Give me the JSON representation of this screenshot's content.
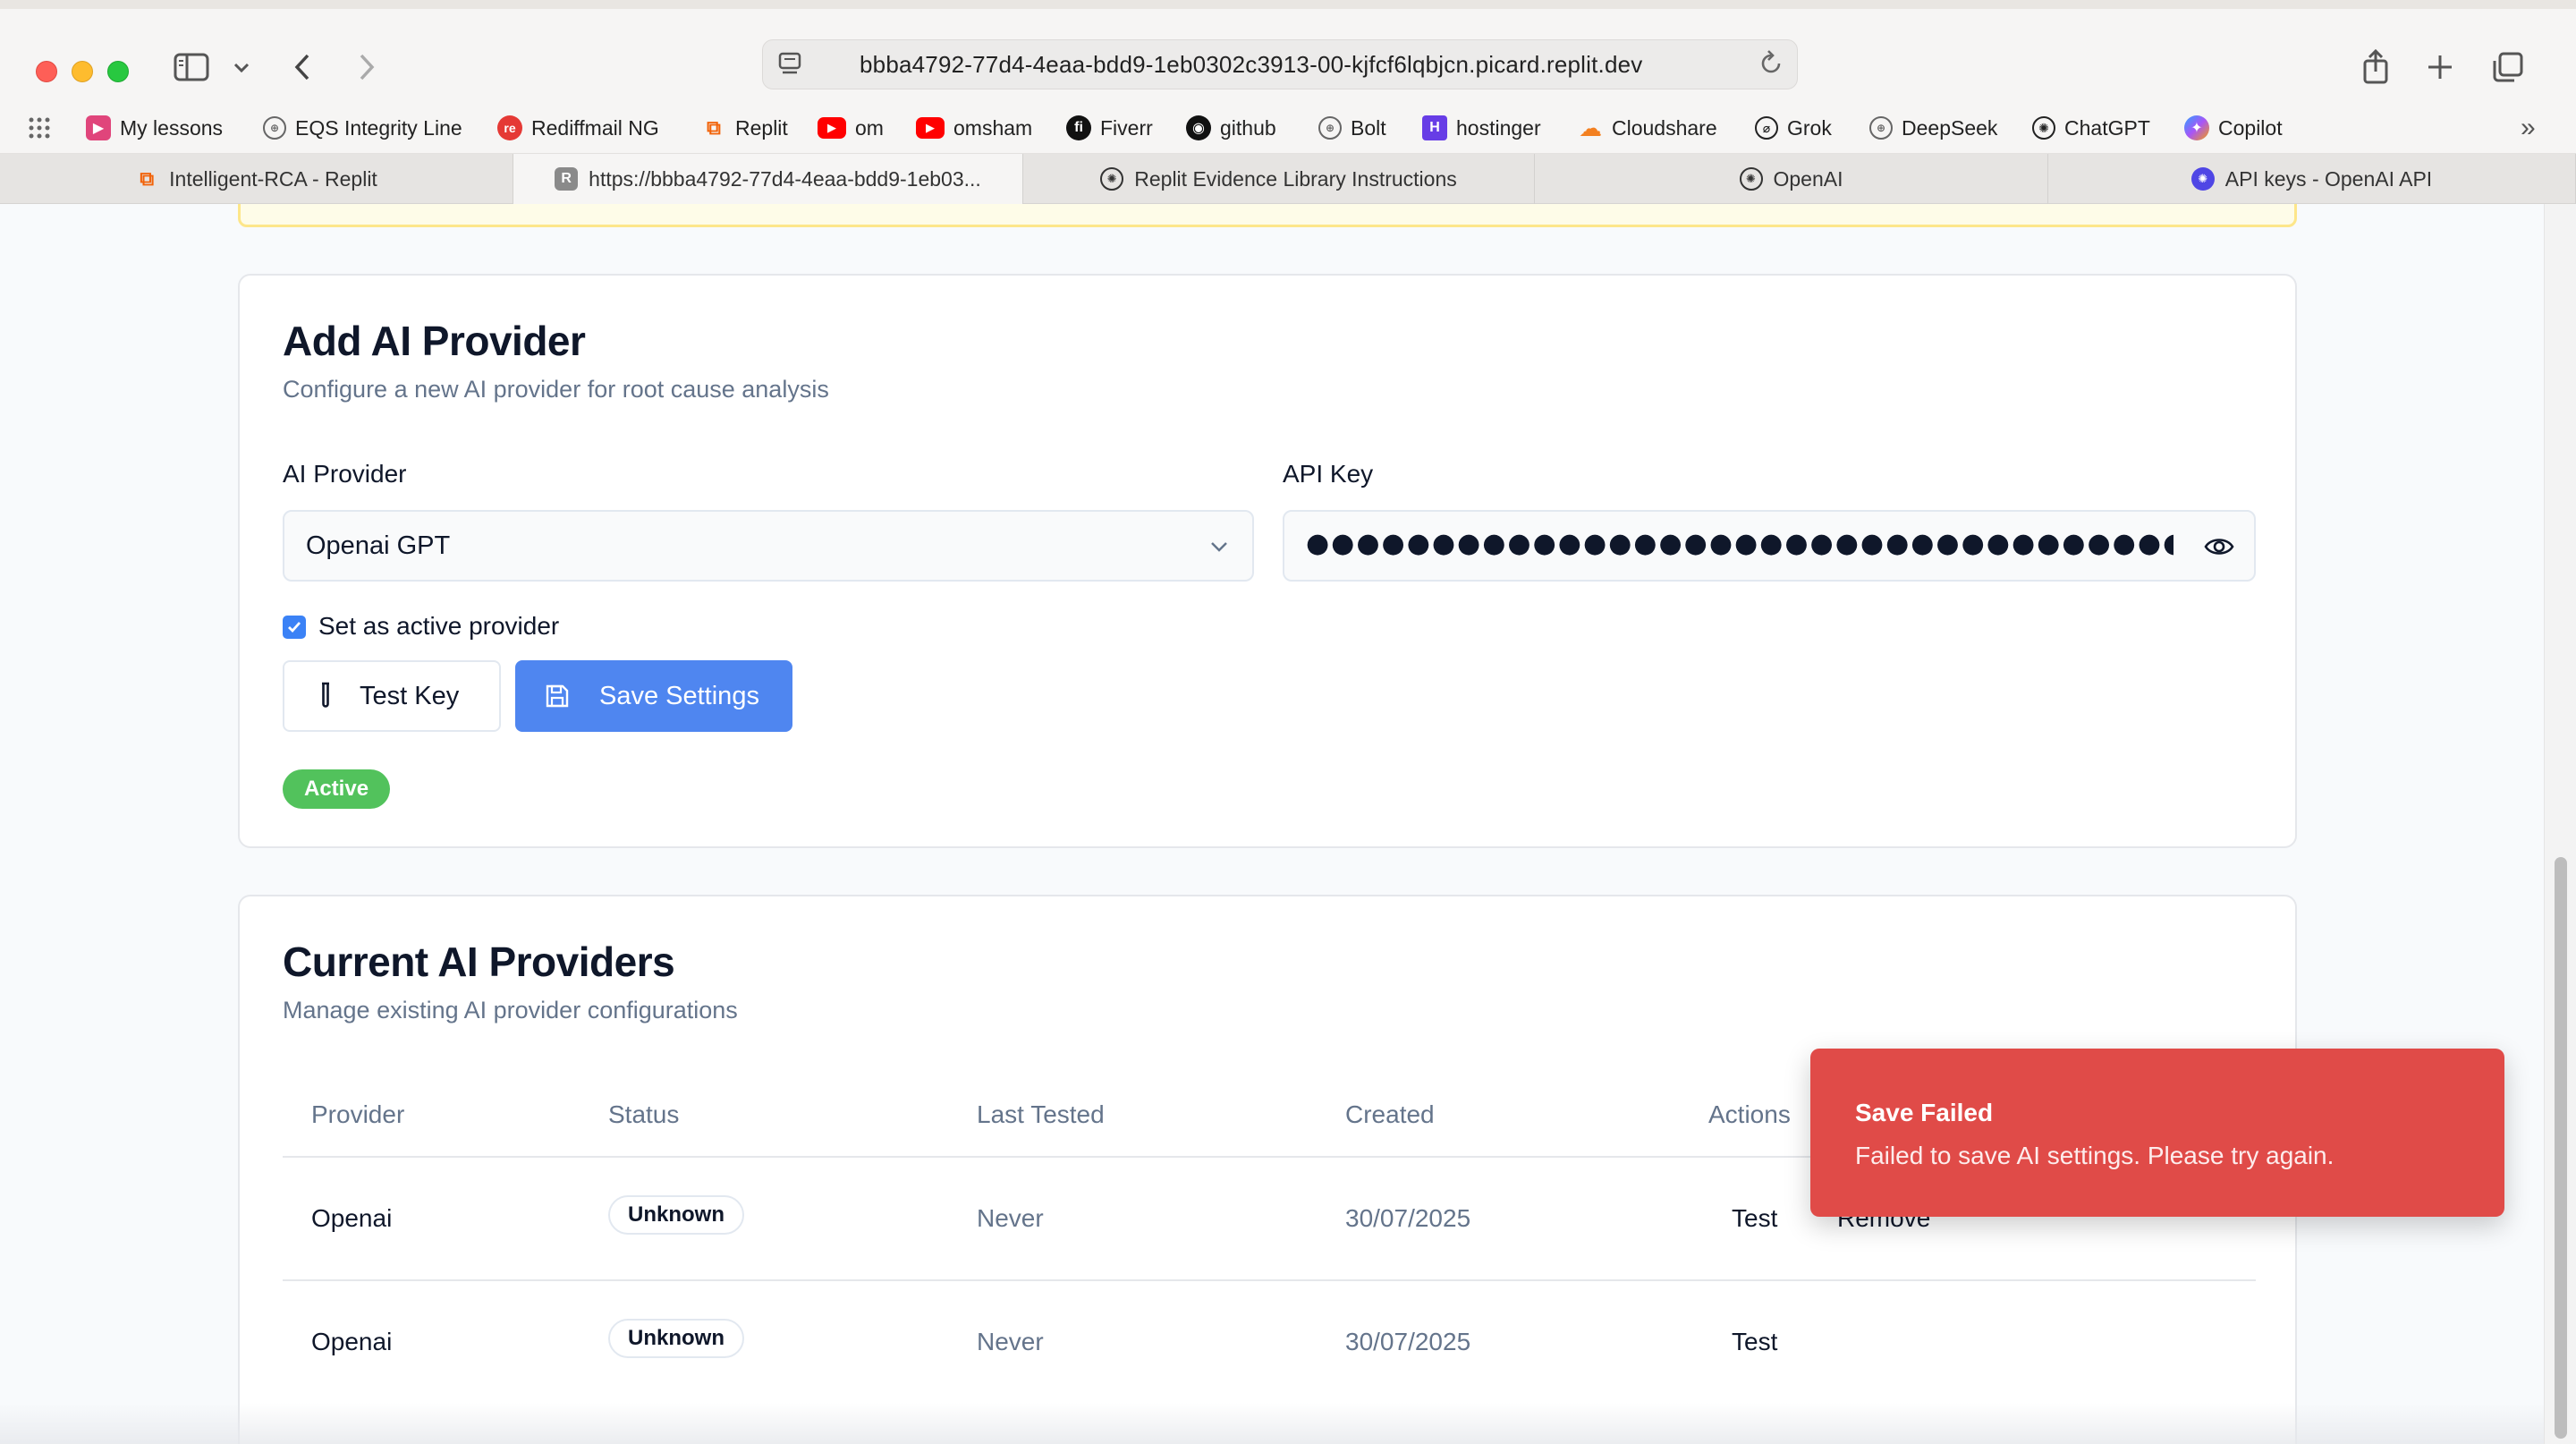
{
  "browser": {
    "url": "bbba4792-77d4-4eaa-bdd9-1eb0302c3913-00-kjfcf6lqbjcn.picard.replit.dev",
    "bookmarks": [
      {
        "label": "My lessons",
        "icon": "lessons-icon"
      },
      {
        "label": "EQS Integrity Line",
        "icon": "globe-icon"
      },
      {
        "label": "Rediffmail NG",
        "icon": "rediff-icon"
      },
      {
        "label": "Replit",
        "icon": "replit-icon"
      },
      {
        "label": "om",
        "icon": "youtube-icon"
      },
      {
        "label": "omsham",
        "icon": "youtube-icon"
      },
      {
        "label": "Fiverr",
        "icon": "fiverr-icon"
      },
      {
        "label": "github",
        "icon": "github-icon"
      },
      {
        "label": "Bolt",
        "icon": "globe-icon"
      },
      {
        "label": "hostinger",
        "icon": "hostinger-icon"
      },
      {
        "label": "Cloudshare",
        "icon": "cloud-icon"
      },
      {
        "label": "Grok",
        "icon": "grok-icon"
      },
      {
        "label": "DeepSeek",
        "icon": "globe-icon"
      },
      {
        "label": "ChatGPT",
        "icon": "openai-icon"
      },
      {
        "label": "Copilot",
        "icon": "copilot-icon"
      }
    ],
    "tabs": [
      {
        "label": "Intelligent-RCA - Replit"
      },
      {
        "label": "https://bbba4792-77d4-4eaa-bdd9-1eb03..."
      },
      {
        "label": "Replit Evidence Library Instructions"
      },
      {
        "label": "OpenAI"
      },
      {
        "label": "API keys - OpenAI API"
      }
    ]
  },
  "add_provider": {
    "title": "Add AI Provider",
    "subtitle": "Configure a new AI provider for root cause analysis",
    "provider_label": "AI Provider",
    "provider_value": "Openai GPT",
    "api_key_label": "API Key",
    "api_key_masked": "●●●●●●●●●●●●●●●●●●●●●●●●●●●●●●●●●●●●●●●●●●●●●●●●●●●●●●●●●●●●●●●●",
    "active_checkbox_label": "Set as active provider",
    "active_checked": true,
    "test_key_label": "Test Key",
    "save_label": "Save Settings",
    "status_badge": "Active"
  },
  "current_providers": {
    "title": "Current AI Providers",
    "subtitle": "Manage existing AI provider configurations",
    "columns": {
      "provider": "Provider",
      "status": "Status",
      "last_tested": "Last Tested",
      "created": "Created",
      "actions": "Actions"
    },
    "rows": [
      {
        "provider": "Openai",
        "status": "Unknown",
        "last_tested": "Never",
        "created": "30/07/2025",
        "test": "Test",
        "remove": "Remove"
      },
      {
        "provider": "Openai",
        "status": "Unknown",
        "last_tested": "Never",
        "created": "30/07/2025",
        "test": "Test"
      }
    ]
  },
  "toast": {
    "title": "Save Failed",
    "message": "Failed to save AI settings. Please try again."
  },
  "colors": {
    "primary": "#4f86f0",
    "active_badge": "#52c25c",
    "toast_error": "#e04b48"
  }
}
